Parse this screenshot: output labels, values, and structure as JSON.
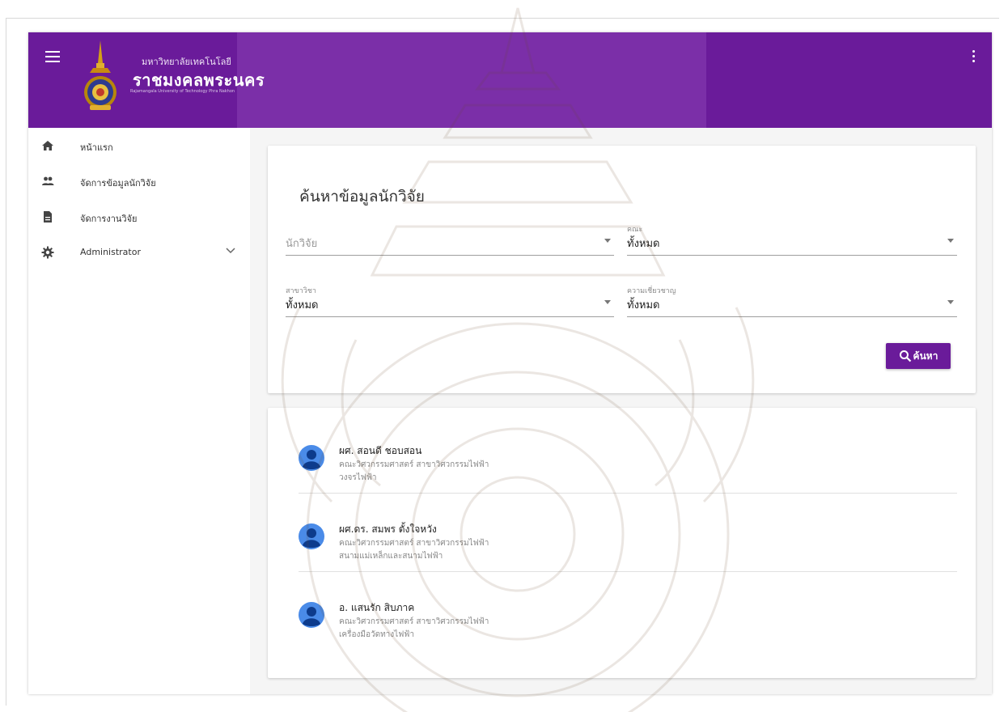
{
  "header": {
    "brand_top": "มหาวิทยาลัยเทคโนโลยี",
    "brand_main": "ราชมงคลพระนคร",
    "brand_sub": "Rajamangala University of Technology Phra Nakhon",
    "accent_color": "#6a1b9a"
  },
  "sidebar": {
    "items": [
      {
        "label": "หน้าแรก",
        "icon": "home-icon"
      },
      {
        "label": "จัดการข้อมูลนักวิจัย",
        "icon": "people-icon"
      },
      {
        "label": "จัดการงานวิจัย",
        "icon": "document-icon"
      },
      {
        "label": "Administrator",
        "icon": "gear-icon"
      }
    ]
  },
  "search": {
    "title": "ค้นหาข้อมูลนักวิจัย",
    "researcher_placeholder": "นักวิจัย",
    "faculty_label": "คณะ",
    "faculty_value": "ทั้งหมด",
    "major_label": "สาขาวิชา",
    "major_value": "ทั้งหมด",
    "expertise_label": "ความเชี่ยวชาญ",
    "expertise_value": "ทั้งหมด",
    "button_label": "ค้นหา"
  },
  "results": [
    {
      "name": "ผศ. สอนดี ชอบสอน",
      "line1": "คณะวิศวกรรมศาสตร์ สาขาวิศวกรรมไฟฟ้า",
      "line2": "วงจรไฟฟ้า"
    },
    {
      "name": "ผศ.ดร. สมพร ตั้งใจหวัง",
      "line1": "คณะวิศวกรรมศาสตร์ สาขาวิศวกรรมไฟฟ้า",
      "line2": "สนามแม่เหล็กและสนามไฟฟ้า"
    },
    {
      "name": "อ. แสนรัก สิบภาค",
      "line1": "คณะวิศวกรรมศาสตร์ สาขาวิศวกรรมไฟฟ้า",
      "line2": "เครื่องมือวัดทางไฟฟ้า"
    }
  ]
}
